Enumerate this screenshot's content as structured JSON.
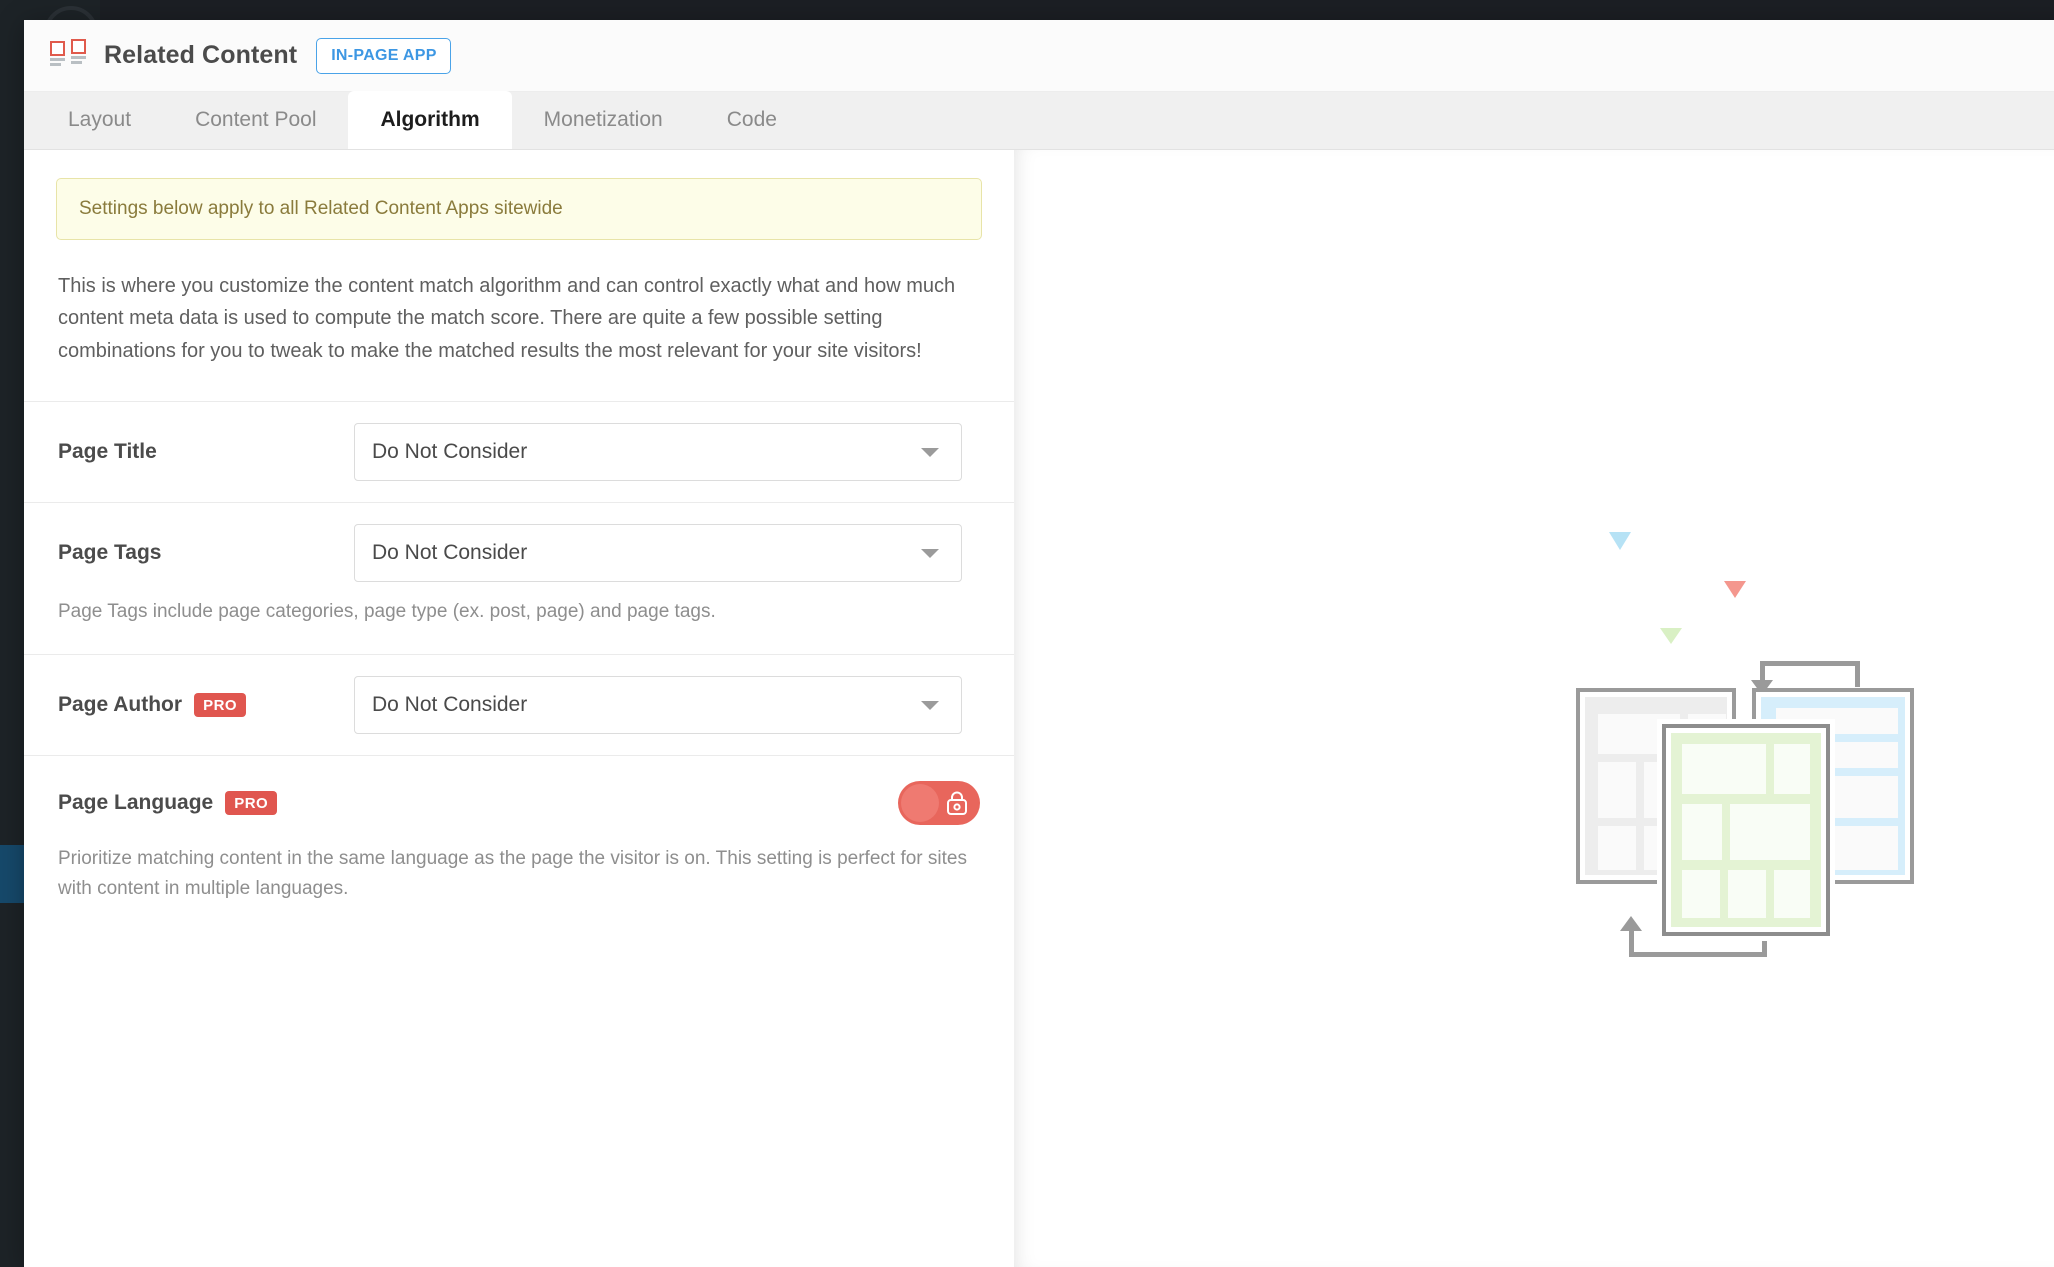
{
  "window": {
    "title": "Related Content",
    "badge": "IN-PAGE APP",
    "logo_icon": "related-content-logo-icon"
  },
  "tabs": [
    {
      "label": "Layout",
      "active": false
    },
    {
      "label": "Content Pool",
      "active": false
    },
    {
      "label": "Algorithm",
      "active": true
    },
    {
      "label": "Monetization",
      "active": false
    },
    {
      "label": "Code",
      "active": false
    }
  ],
  "notice": {
    "text": "Settings below apply to all Related Content Apps sitewide"
  },
  "intro": {
    "text": "This is where you customize the content match algorithm and can control exactly what and how much content meta data is used to compute the match score. There are quite a few possible setting combinations for you to tweak to make the matched results the most relevant for your site visitors!"
  },
  "settings": {
    "page_title": {
      "label": "Page Title",
      "value": "Do Not Consider",
      "caret_icon": "chevron-down-icon"
    },
    "page_tags": {
      "label": "Page Tags",
      "value": "Do Not Consider",
      "caret_icon": "chevron-down-icon",
      "help": "Page Tags include page categories, page type (ex. post, page) and page tags."
    },
    "page_author": {
      "label": "Page Author",
      "badge": "PRO",
      "value": "Do Not Consider",
      "caret_icon": "chevron-down-icon"
    },
    "page_language": {
      "label": "Page Language",
      "badge": "PRO",
      "toggle_icon": "lock-icon",
      "help": "Prioritize matching content in the same language as the page the visitor is on. This setting is perfect for sites with content in multiple languages."
    }
  },
  "preview": {
    "illustration_name": "related-content-pages-illustration"
  },
  "colors": {
    "accent_red": "#e0564f",
    "accent_blue": "#3d97e3",
    "toggle_red": "#e8665c",
    "notice_bg": "#fdfde8",
    "notice_text": "#8a7b3c"
  }
}
